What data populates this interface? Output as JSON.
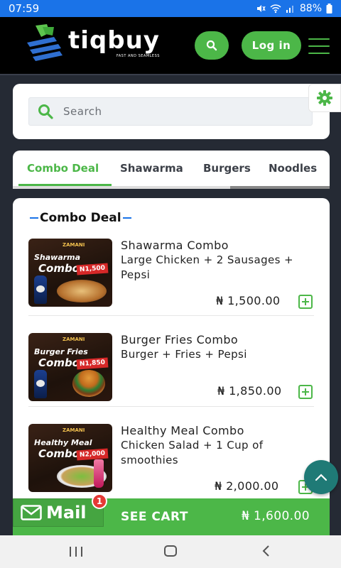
{
  "status_bar": {
    "time": "07:59",
    "battery": "88%"
  },
  "header": {
    "logo_text": "tiqbuy",
    "logo_tagline": "FAST AND SEAMLESS",
    "login_label": "Log in"
  },
  "search": {
    "placeholder": "Search"
  },
  "tabs": [
    {
      "label": "Combo Deal",
      "active": true
    },
    {
      "label": "Shawarma",
      "active": false
    },
    {
      "label": "Burgers",
      "active": false
    },
    {
      "label": "Noodles",
      "active": false
    }
  ],
  "section": {
    "title": "Combo Deal"
  },
  "items": [
    {
      "name": "Shawarma Combo",
      "description": "Large Chicken + 2 Sausages + Pepsi",
      "price": "₦ 1,500.00",
      "image": {
        "brand": "ZAMANI",
        "line1": "Shawarma",
        "line2": "Combo",
        "tag": "N1,500"
      }
    },
    {
      "name": "Burger Fries Combo",
      "description": "Burger + Fries + Pepsi",
      "price": "₦ 1,850.00",
      "image": {
        "brand": "ZAMANI",
        "line1": "Burger Fries",
        "line2": "Combo",
        "tag": "N1,850"
      }
    },
    {
      "name": "Healthy Meal Combo",
      "description": "Chicken Salad + 1 Cup of smoothies",
      "price": "₦ 2,000.00",
      "image": {
        "brand": "ZAMANI",
        "line1": "Healthy Meal",
        "line2": "Combo",
        "tag": "N2,000"
      }
    }
  ],
  "cart": {
    "mail_label": "Mail",
    "mail_badge": "1",
    "see_cart_label": "SEE CART",
    "total": "₦ 1,600.00"
  },
  "colors": {
    "accent_green": "#4cb748",
    "status_blue": "#1a73e8",
    "header_black": "#000000"
  }
}
